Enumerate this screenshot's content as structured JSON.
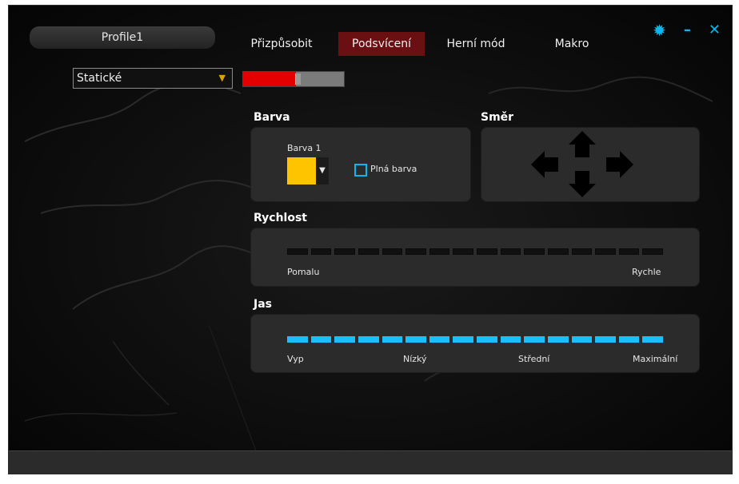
{
  "app": {
    "profile_label": "Profile1",
    "tabs": [
      {
        "label": "Přizpůsobit",
        "active": false
      },
      {
        "label": "Podsvícení",
        "active": true
      },
      {
        "label": "Herní mód",
        "active": false
      },
      {
        "label": "Makro",
        "active": false
      }
    ],
    "window_controls": {
      "settings_icon": "gear-icon",
      "minimize_icon": "minimize-icon",
      "close_icon": "close-icon"
    },
    "accent_color": "#0fb6e9",
    "active_tab_color": "#6a0f12"
  },
  "lighting_mode": {
    "selected": "Statické"
  },
  "brightness_toggle": {
    "value_fraction": 0.52,
    "fill_color": "#e50000"
  },
  "barva": {
    "title": "Barva",
    "color1_label": "Barva 1",
    "color1_value": "#ffc400",
    "full_color_label": "Plná barva",
    "full_color_checked": false
  },
  "smer": {
    "title": "Směr",
    "icons": [
      "arrow-left-icon",
      "arrow-up-icon",
      "arrow-right-icon",
      "arrow-down-icon"
    ]
  },
  "rychlost": {
    "title": "Rychlost",
    "segments": 16,
    "selected_segments": 0,
    "min_label": "Pomalu",
    "max_label": "Rychle"
  },
  "jas": {
    "title": "Jas",
    "segments": 16,
    "selected_segments": 16,
    "labels": [
      "Vyp",
      "Nízký",
      "Střední",
      "Maximální"
    ]
  }
}
